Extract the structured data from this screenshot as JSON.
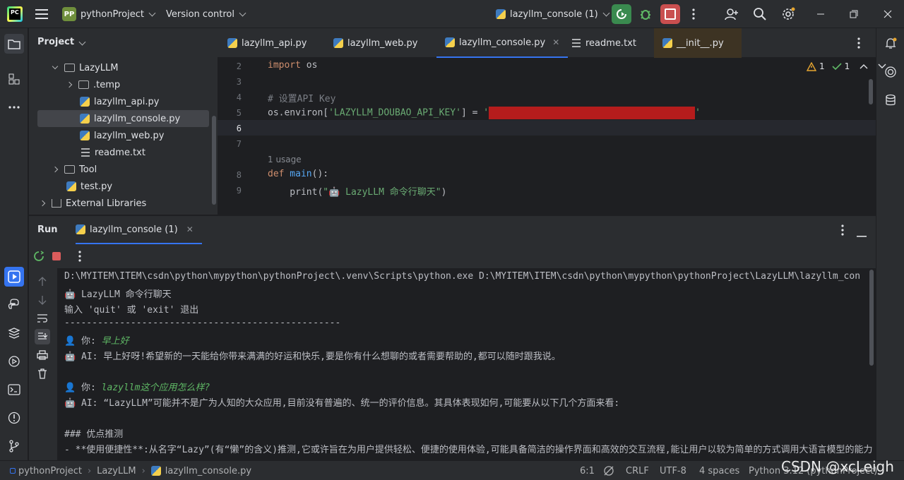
{
  "titlebar": {
    "app_logo": "PC",
    "project_badge": "PP",
    "project_name": "pythonProject",
    "version_control": "Version control",
    "run_config": "lazyllm_console (1)"
  },
  "project_panel": {
    "title": "Project",
    "items": [
      {
        "label": "LazyLLM",
        "type": "folder",
        "expanded": true
      },
      {
        "label": ".temp",
        "type": "folder",
        "expanded": false
      },
      {
        "label": "lazyllm_api.py",
        "type": "py"
      },
      {
        "label": "lazyllm_console.py",
        "type": "py",
        "selected": true
      },
      {
        "label": "lazyllm_web.py",
        "type": "py"
      },
      {
        "label": "readme.txt",
        "type": "txt"
      },
      {
        "label": "Tool",
        "type": "folder",
        "expanded": false
      },
      {
        "label": "test.py",
        "type": "py"
      },
      {
        "label": "External Libraries",
        "type": "lib",
        "expanded": false
      }
    ]
  },
  "tabs": [
    {
      "label": "lazyllm_api.py"
    },
    {
      "label": "lazyllm_web.py"
    },
    {
      "label": "lazyllm_console.py",
      "active": true
    },
    {
      "label": "readme.txt"
    },
    {
      "label": "__init__.py"
    }
  ],
  "editor": {
    "warnings": "1",
    "checks": "1",
    "line_numbers": [
      "2",
      "3",
      "4",
      "5",
      "6",
      "7",
      "8",
      "9"
    ],
    "lines": {
      "l2_kw": "import",
      "l2_rest": " os",
      "l4": "# 设置API Key",
      "l5_a": "os.environ[",
      "l5_b": "'LAZYLLM_DOUBAO_API_KEY'",
      "l5_c": "] = ",
      "l5_d": "'",
      "l5_e": "'",
      "usage": "1 usage",
      "l8_kw": "def",
      "l8_fn": " main",
      "l8_rest": "():",
      "l9_a": "    print(",
      "l9_b": "\"🤖 LazyLLM 命令行聊天\"",
      "l9_c": ")"
    }
  },
  "run_panel": {
    "title": "Run",
    "tab": "lazyllm_console (1)",
    "console": {
      "cmd": "D:\\MYITEM\\ITEM\\csdn\\python\\mypython\\pythonProject\\.venv\\Scripts\\python.exe D:\\MYITEM\\ITEM\\csdn\\python\\mypython\\pythonProject\\LazyLLM\\lazyllm_con",
      "banner": "🤖 LazyLLM 命令行聊天",
      "hint": "输入 'quit' 或 'exit' 退出",
      "sep": "--------------------------------------------------",
      "you1_prefix": "👤 你: ",
      "you1": "早上好",
      "ai1": "🤖 AI: 早上好呀!希望新的一天能给你带来满满的好运和快乐,要是你有什么想聊的或者需要帮助的,都可以随时跟我说。",
      "you2_prefix": "👤 你: ",
      "you2": "lazyllm这个应用怎么样?",
      "ai2": "🤖 AI: “LazyLLM”可能并不是广为人知的大众应用,目前没有普遍的、统一的评价信息。其具体表现如何,可能要从以下几个方面来看:",
      "h3": "### 优点推测",
      "bullet": "- **使用便捷性**:从名字“Lazy”(有“懒”的含义)推测,它或许旨在为用户提供轻松、便捷的使用体验,可能具备简洁的操作界面和高效的交互流程,能让用户以较为简单的方式调用大语言模型的能力"
    }
  },
  "status": {
    "crumb1": "pythonProject",
    "crumb2": "LazyLLM",
    "crumb3": "lazyllm_console.py",
    "pos": "6:1",
    "crlf": "CRLF",
    "enc": "UTF-8",
    "indent": "4 spaces",
    "interp": "Python 3.12 (pythonProject)",
    "watermark": "CSDN @xcLeigh"
  }
}
